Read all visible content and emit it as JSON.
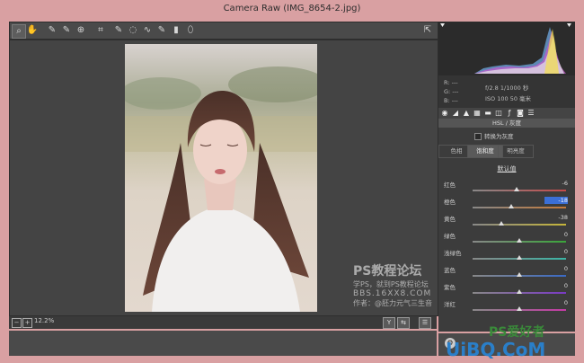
{
  "window": {
    "title": "Camera Raw (IMG_8654-2.jpg)"
  },
  "toolbar": {
    "tools": [
      {
        "name": "zoom-tool",
        "glyph": "⌕"
      },
      {
        "name": "hand-tool",
        "glyph": "✋"
      },
      {
        "name": "white-balance-tool",
        "glyph": "✎"
      },
      {
        "name": "color-sampler-tool",
        "glyph": "✎"
      },
      {
        "name": "target-adjust-tool",
        "glyph": "⊕"
      },
      {
        "name": "crop-tool",
        "glyph": "⌗"
      },
      {
        "name": "straighten-tool",
        "glyph": "✎"
      },
      {
        "name": "spot-removal-tool",
        "glyph": "◌"
      },
      {
        "name": "red-eye-tool",
        "glyph": "∿"
      },
      {
        "name": "adjustment-brush-tool",
        "glyph": "✎"
      },
      {
        "name": "graduated-filter-tool",
        "glyph": "▮"
      },
      {
        "name": "radial-filter-tool",
        "glyph": "⬯"
      }
    ],
    "fullscreen_glyph": "⇱"
  },
  "canvas": {
    "watermark": {
      "line1": "PS教程论坛",
      "line2": "学PS，就到PS教程论坛",
      "line3": "BBS.16XX8.COM",
      "line4": "作者：@胚力元气三生音"
    }
  },
  "statusbar": {
    "zoom": "12.2%",
    "zoom_out": "−",
    "zoom_in": "+",
    "buttons": [
      "Y",
      "⇆",
      "☰"
    ]
  },
  "info": {
    "rgb": {
      "r": "R:",
      "g": "G:",
      "b": "B:",
      "placeholder": "---"
    },
    "exposure": "f/2.8   1/1000 秒",
    "iso": "ISO 100   50 毫米"
  },
  "panel": {
    "section_title": "HSL / 灰度",
    "convert_label": "转换为灰度",
    "tabs": [
      "色相",
      "饱和度",
      "明亮度"
    ],
    "active_tab": 1,
    "subsection": "默认值",
    "sliders": [
      {
        "label": "红色",
        "value": "-6",
        "amount": -6,
        "color": "#c54a4a"
      },
      {
        "label": "橙色",
        "value": "-18",
        "amount": -18,
        "color": "#c57a3a",
        "active": true
      },
      {
        "label": "黄色",
        "value": "-38",
        "amount": -38,
        "color": "#c5b53a"
      },
      {
        "label": "绿色",
        "value": "0",
        "amount": 0,
        "color": "#3aa53a"
      },
      {
        "label": "浅绿色",
        "value": "0",
        "amount": 0,
        "color": "#3ab5a5"
      },
      {
        "label": "蓝色",
        "value": "0",
        "amount": 0,
        "color": "#3a6ac5"
      },
      {
        "label": "紫色",
        "value": "0",
        "amount": 0,
        "color": "#7a3ac5"
      },
      {
        "label": "洋红",
        "value": "0",
        "amount": 0,
        "color": "#c53aa5"
      }
    ]
  },
  "branding": {
    "logo_text": "PS爱好者",
    "site": "UiBQ.CoM"
  }
}
